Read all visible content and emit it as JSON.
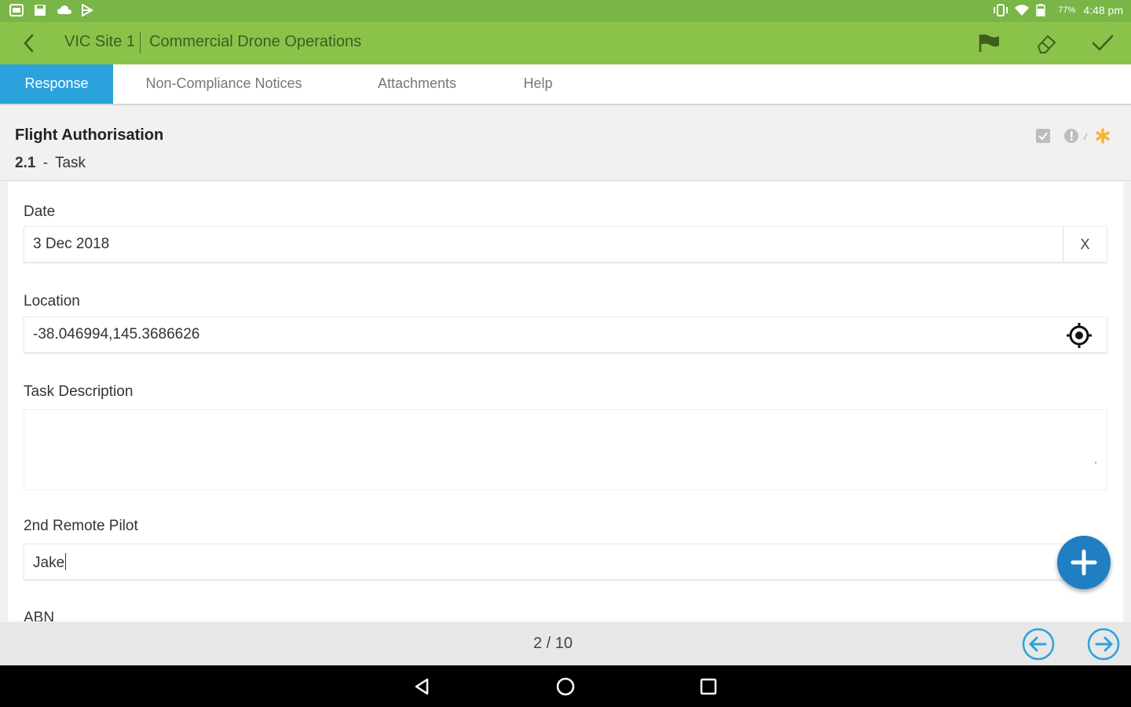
{
  "status_bar": {
    "battery": "77%",
    "time": "4:48 pm"
  },
  "app_bar": {
    "site": "VIC Site 1",
    "title": "Commercial Drone Operations"
  },
  "tabs": [
    {
      "label": "Response",
      "active": true
    },
    {
      "label": "Non-Compliance Notices",
      "active": false
    },
    {
      "label": "Attachments",
      "active": false
    },
    {
      "label": "Help",
      "active": false
    }
  ],
  "section": {
    "title": "Flight Authorisation",
    "number": "2.1",
    "separator": "-",
    "name": "Task"
  },
  "form": {
    "date": {
      "label": "Date",
      "value": "3 Dec 2018",
      "clear_label": "X"
    },
    "location": {
      "label": "Location",
      "value": "-38.046994,145.3686626"
    },
    "task_description": {
      "label": "Task Description",
      "value": ""
    },
    "second_pilot": {
      "label": "2nd Remote Pilot",
      "value": "Jake"
    },
    "abn": {
      "label": "ABN"
    }
  },
  "pager": {
    "current": 2,
    "total": 10,
    "text": "2 / 10"
  },
  "colors": {
    "status_bar": "#7ab547",
    "app_bar": "#8bc34a",
    "tab_active": "#2aa3dc",
    "fab": "#1f7fc2",
    "star": "#f5b335"
  }
}
